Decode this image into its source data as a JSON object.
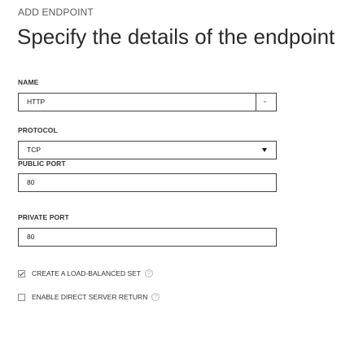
{
  "dialog": {
    "label": "ADD ENDPOINT",
    "title": "Specify the details of the endpoint"
  },
  "fields": {
    "name": {
      "label": "NAME",
      "value": "HTTP"
    },
    "protocol": {
      "label": "PROTOCOL",
      "value": "TCP"
    },
    "public_port": {
      "label": "PUBLIC PORT",
      "value": "80"
    },
    "private_port": {
      "label": "PRIVATE PORT",
      "value": "80"
    }
  },
  "options": {
    "load_balanced": {
      "label": "CREATE A LOAD-BALANCED SET",
      "checked": true
    },
    "direct_return": {
      "label": "ENABLE DIRECT SERVER RETURN",
      "checked": false
    }
  },
  "icons": {
    "name_dropdown": "chevron-down-icon",
    "protocol_dropdown": "triangle-down-icon",
    "help": "help-icon"
  }
}
